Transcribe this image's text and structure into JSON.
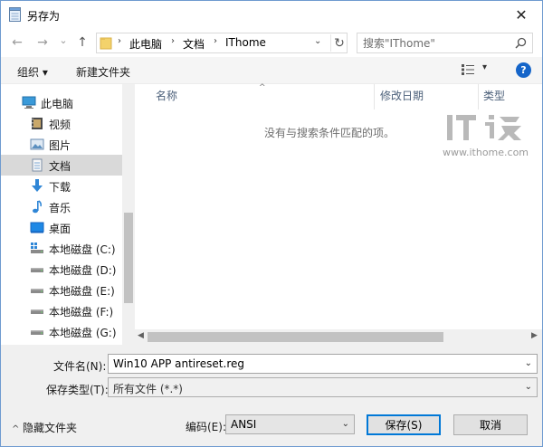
{
  "window": {
    "title": "另存为",
    "close_glyph": "✕"
  },
  "nav": {
    "back_glyph": "←",
    "forward_glyph": "→",
    "recent_glyph": "⌄",
    "up_glyph": "↑",
    "breadcrumbs": [
      "此电脑",
      "文档",
      "IThome"
    ],
    "crumb_separator": "›",
    "dropdown_glyph": "⌄",
    "refresh_glyph": "↻",
    "search_placeholder": "搜索\"IThome\""
  },
  "toolbar": {
    "organize_label": "组织 ▾",
    "new_folder_label": "新建文件夹",
    "views_dropdown_glyph": "▾",
    "help_label": "?"
  },
  "sidebar": {
    "items": [
      {
        "label": "此电脑",
        "icon": "computer-icon"
      },
      {
        "label": "视频",
        "icon": "video-icon"
      },
      {
        "label": "图片",
        "icon": "pictures-icon"
      },
      {
        "label": "文档",
        "icon": "documents-icon",
        "selected": true
      },
      {
        "label": "下载",
        "icon": "download-icon"
      },
      {
        "label": "音乐",
        "icon": "music-icon"
      },
      {
        "label": "桌面",
        "icon": "desktop-icon"
      },
      {
        "label": "本地磁盘 (C:)",
        "icon": "system-drive-icon"
      },
      {
        "label": "本地磁盘 (D:)",
        "icon": "drive-icon"
      },
      {
        "label": "本地磁盘 (E:)",
        "icon": "drive-icon"
      },
      {
        "label": "本地磁盘 (F:)",
        "icon": "drive-icon"
      },
      {
        "label": "本地磁盘 (G:)",
        "icon": "drive-icon"
      }
    ]
  },
  "list": {
    "columns": [
      "名称",
      "修改日期",
      "类型"
    ],
    "sort_glyph": "^",
    "empty_message": "没有与搜索条件匹配的项。"
  },
  "scroll": {
    "left_glyph": "◀",
    "right_glyph": "▶"
  },
  "watermark": {
    "url": "www.ithome.com"
  },
  "form": {
    "filename_label": "文件名(N):",
    "filename_value": "Win10 APP antireset.reg",
    "filetype_label": "保存类型(T):",
    "filetype_value": "所有文件 (*.*)",
    "dropdown_glyph": "⌄"
  },
  "footer": {
    "hide_folders_caret": "^",
    "hide_folders_label": "隐藏文件夹",
    "encoding_label": "编码(E):",
    "encoding_value": "ANSI",
    "save_label": "保存(S)",
    "cancel_label": "取消"
  },
  "colors": {
    "accent": "#0078d7",
    "help_blue": "#1565c9",
    "header_text": "#4c607a"
  }
}
